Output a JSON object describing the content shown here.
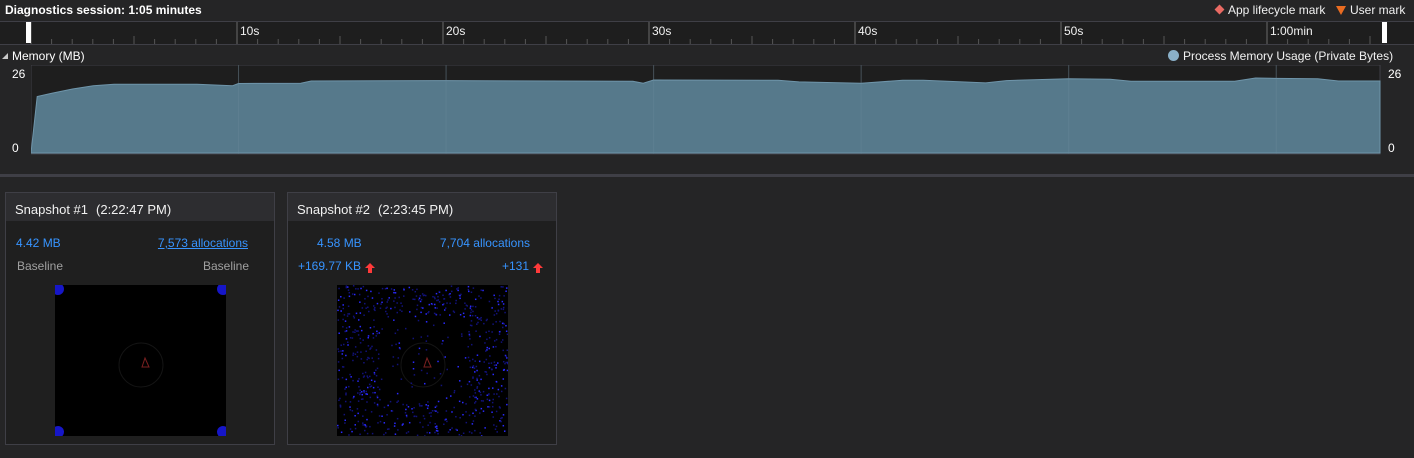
{
  "header": {
    "session_title": "Diagnostics session: 1:05 minutes",
    "legend_lifecycle": "App lifecycle mark",
    "legend_user": "User mark",
    "lifecycle_color": "#e96a63",
    "user_color": "#ea6c21"
  },
  "ruler": {
    "ticks": [
      "10s",
      "20s",
      "30s",
      "40s",
      "50s",
      "1:00min"
    ]
  },
  "memory": {
    "title": "Memory (MB)",
    "series_label": "Process Memory Usage (Private Bytes)",
    "series_color": "#5a7e91",
    "y_max_label": "26",
    "y_min_label": "0"
  },
  "chart_data": {
    "type": "area",
    "title": "Memory (MB)",
    "x_unit": "s",
    "xlim": [
      0,
      65
    ],
    "ylim": [
      0,
      26
    ],
    "series": [
      {
        "name": "Process Memory Usage (Private Bytes)",
        "x": [
          0,
          0.3,
          1,
          2,
          3,
          4,
          5,
          8,
          9.7,
          10,
          13,
          13.5,
          19.5,
          20,
          29,
          29.5,
          30,
          36,
          37,
          40,
          42,
          43,
          46,
          47,
          50,
          52,
          53,
          58,
          59,
          60,
          62,
          63,
          65
        ],
        "values": [
          0,
          17.5,
          18.5,
          19.8,
          20.8,
          21.3,
          21.3,
          21.3,
          20.8,
          21.5,
          21.6,
          22.3,
          22.4,
          22.4,
          22.2,
          21.6,
          22.6,
          22.5,
          22.0,
          21.6,
          22.5,
          22.5,
          21.7,
          22.4,
          23.0,
          22.8,
          22.2,
          22.2,
          23.2,
          23.1,
          23.0,
          22.3,
          22.3
        ]
      }
    ]
  },
  "snapshots": [
    {
      "title": "Snapshot #1",
      "time": "(2:22:47 PM)",
      "size": "4.42 MB",
      "allocations": "7,573 allocations",
      "size_diff": "Baseline",
      "alloc_diff": "Baseline"
    },
    {
      "title": "Snapshot #2",
      "time": "(2:23:45 PM)",
      "size": "4.58 MB",
      "allocations": "7,704 allocations",
      "size_diff": "+169.77 KB",
      "alloc_diff": "+131"
    }
  ]
}
